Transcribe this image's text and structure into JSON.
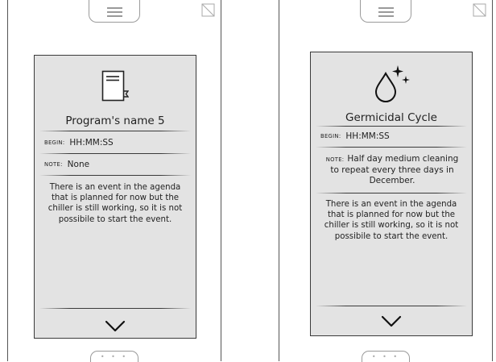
{
  "screens": [
    {
      "title": "Program's name 5",
      "icon": "program-book-icon",
      "begin_label": "BEGIN:",
      "begin_value": "HH:MM:SS",
      "note_label": "NOTE:",
      "note_value": "None",
      "message": "There is an event in the agenda that is planned for now but the chiller is still working, so it is not possibile to start the event.",
      "confirm_icon": "checkmark-icon"
    },
    {
      "title": "Germicidal Cycle",
      "icon": "germicidal-drop-icon",
      "begin_label": "BEGIN:",
      "begin_value": "HH:MM:SS",
      "note_label": "NOTE:",
      "note_value": "Half day medium cleaning to repeat every three days in December.",
      "message": "There is an event in the agenda that is planned for now but the chiller is still working, so it is not possibile to start the event.",
      "confirm_icon": "checkmark-icon"
    }
  ],
  "chrome": {
    "menu_icon": "hamburger-menu-icon",
    "corner_icon": "no-signal-icon",
    "bottom_indicator": "• • •"
  }
}
